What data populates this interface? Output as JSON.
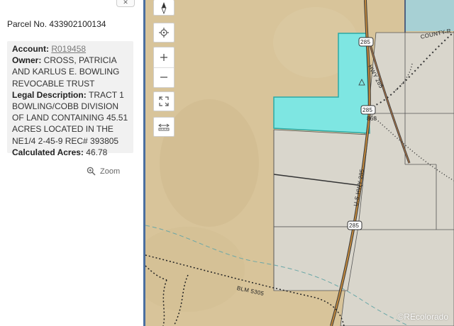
{
  "panel": {
    "parcel_title": "Parcel No. 433902100134",
    "account_label": "Account:",
    "account_value": "R019458",
    "owner_label": "Owner:",
    "owner_value": "CROSS, PATRICIA AND KARLUS E. BOWLING REVOCABLE TRUST",
    "legal_label": "Legal Description:",
    "legal_value": "TRACT 1 BOWLING/COBB DIVISION OF LAND CONTAINING 45.51 ACRES LOCATED IN THE NE1/4 2-45-9 REC# 393805",
    "acres_label": "Calculated Acres:",
    "acres_value": "46.78",
    "zoom_label": "Zoom"
  },
  "map": {
    "labels": {
      "county_road": "COUNTY-R",
      "hwy_upper": "HWY 285",
      "hwy_main": "U.S.HWY 285",
      "blm": "BLM 5305",
      "shield_top": "285",
      "shield_mid": "285",
      "shield_low": "285",
      "hwy_number": "868"
    },
    "colors": {
      "parcel_fill": "#7ee6e2",
      "parcel_stroke": "#2aa8a4",
      "terrain": "#d8c49a",
      "lots": "#d9d6cc",
      "water": "#a7d0d4"
    }
  },
  "watermark": "©REcolorado"
}
